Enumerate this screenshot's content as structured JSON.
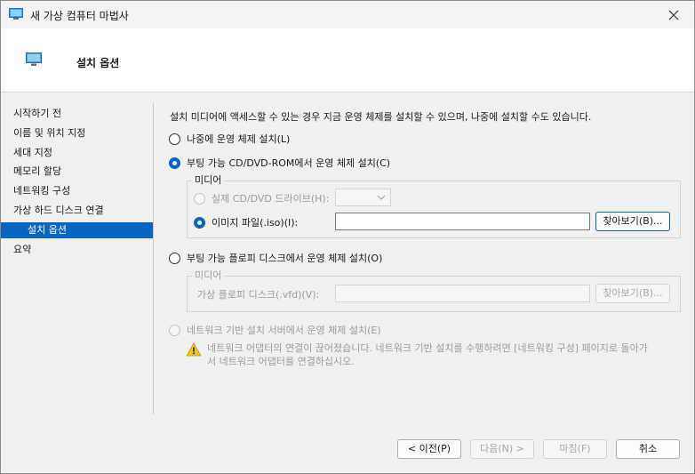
{
  "window": {
    "title": "새 가상 컴퓨터 마법사"
  },
  "header": {
    "title": "설치 옵션"
  },
  "sidebar": {
    "items": [
      {
        "label": "시작하기 전"
      },
      {
        "label": "이름 및 위치 지정"
      },
      {
        "label": "세대 지정"
      },
      {
        "label": "메모리 할당"
      },
      {
        "label": "네트워킹 구성"
      },
      {
        "label": "가상 하드 디스크 연결"
      },
      {
        "label": "설치 옵션",
        "active": true
      },
      {
        "label": "요약"
      }
    ]
  },
  "main": {
    "description": "설치 미디어에 액세스할 수 있는 경우 지금 운영 체제를 설치할 수 있으며, 나중에 설치할 수도 있습니다.",
    "options": {
      "later": {
        "label": "나중에 운영 체제 설치(L)",
        "selected": false
      },
      "cd_dvd": {
        "label": "부팅 가능 CD/DVD-ROM에서 운영 체제 설치(C)",
        "selected": true
      },
      "floppy": {
        "label": "부팅 가능 플로피 디스크에서 운영 체제 설치(O)",
        "selected": false
      },
      "network": {
        "label": "네트워크 기반 설치 서버에서 운영 체제 설치(E)",
        "selected": false,
        "disabled": true
      }
    },
    "cd_media": {
      "legend": "미디어",
      "physical_drive": {
        "label": "실제 CD/DVD 드라이브(H):",
        "value": "",
        "disabled": true
      },
      "image_file": {
        "label": "이미지 파일(.iso)(I):",
        "value": "",
        "selected": true
      },
      "browse_label": "찾아보기(B)..."
    },
    "floppy_media": {
      "legend": "미디어",
      "vfd": {
        "label": "가상 플로피 디스크(.vfd)(V):",
        "value": "",
        "disabled": true
      },
      "browse_label": "찾아보기(B)..."
    },
    "network_warning": {
      "line1": "네트워크 어댑터의 연결이 끊어졌습니다. 네트워크 기반 설치를 수행하려면 [네트워킹 구성] 페이지로 돌아가",
      "line2": "서 네트워크 어댑터를 연결하십시오."
    }
  },
  "footer": {
    "prev_label": "< 이전(P)",
    "next_label": "다음(N) >",
    "finish_label": "마침(F)",
    "cancel_label": "취소"
  },
  "colors": {
    "accent": "#0a64c2",
    "warning": "#f2c811"
  },
  "icons": {
    "app": "monitor-icon",
    "close": "close-icon",
    "dropdown": "chevron-down-icon",
    "warning": "warning-icon"
  }
}
